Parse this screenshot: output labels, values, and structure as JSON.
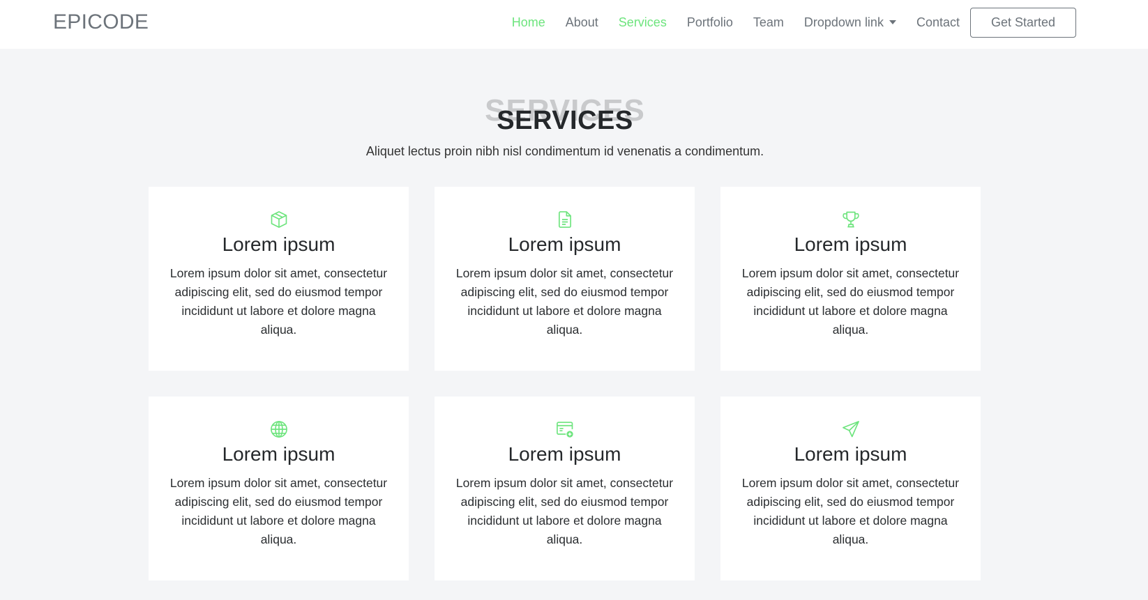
{
  "brand": "EPICODE",
  "nav": {
    "items": [
      {
        "label": "Home"
      },
      {
        "label": "About"
      },
      {
        "label": "Services"
      },
      {
        "label": "Portfolio"
      },
      {
        "label": "Team"
      },
      {
        "label": "Dropdown link"
      },
      {
        "label": "Contact"
      }
    ],
    "cta_label": "Get Started"
  },
  "services": {
    "heading_bg": "SERVICES",
    "heading": "SERVICES",
    "subtitle": "Aliquet lectus proin nibh nisl condimentum id venenatis a condimentum.",
    "cards": [
      {
        "icon": "box-icon",
        "title": "Lorem ipsum",
        "text": "Lorem ipsum dolor sit amet, consectetur adipiscing elit, sed do eiusmod tempor incididunt ut labore et dolore magna aliqua."
      },
      {
        "icon": "file-text-icon",
        "title": "Lorem ipsum",
        "text": "Lorem ipsum dolor sit amet, consectetur adipiscing elit, sed do eiusmod tempor incididunt ut labore et dolore magna aliqua."
      },
      {
        "icon": "trophy-icon",
        "title": "Lorem ipsum",
        "text": "Lorem ipsum dolor sit amet, consectetur adipiscing elit, sed do eiusmod tempor incididunt ut labore et dolore magna aliqua."
      },
      {
        "icon": "globe-icon",
        "title": "Lorem ipsum",
        "text": "Lorem ipsum dolor sit amet, consectetur adipiscing elit, sed do eiusmod tempor incididunt ut labore et dolore magna aliqua."
      },
      {
        "icon": "browser-add-icon",
        "title": "Lorem ipsum",
        "text": "Lorem ipsum dolor sit amet, consectetur adipiscing elit, sed do eiusmod tempor incididunt ut labore et dolore magna aliqua."
      },
      {
        "icon": "send-icon",
        "title": "Lorem ipsum",
        "text": "Lorem ipsum dolor sit amet, consectetur adipiscing elit, sed do eiusmod tempor incididunt ut labore et dolore magna aliqua."
      }
    ]
  },
  "colors": {
    "accent": "#6de47d",
    "nav_text": "#6c737a",
    "page_bg": "#f4f5f7"
  }
}
